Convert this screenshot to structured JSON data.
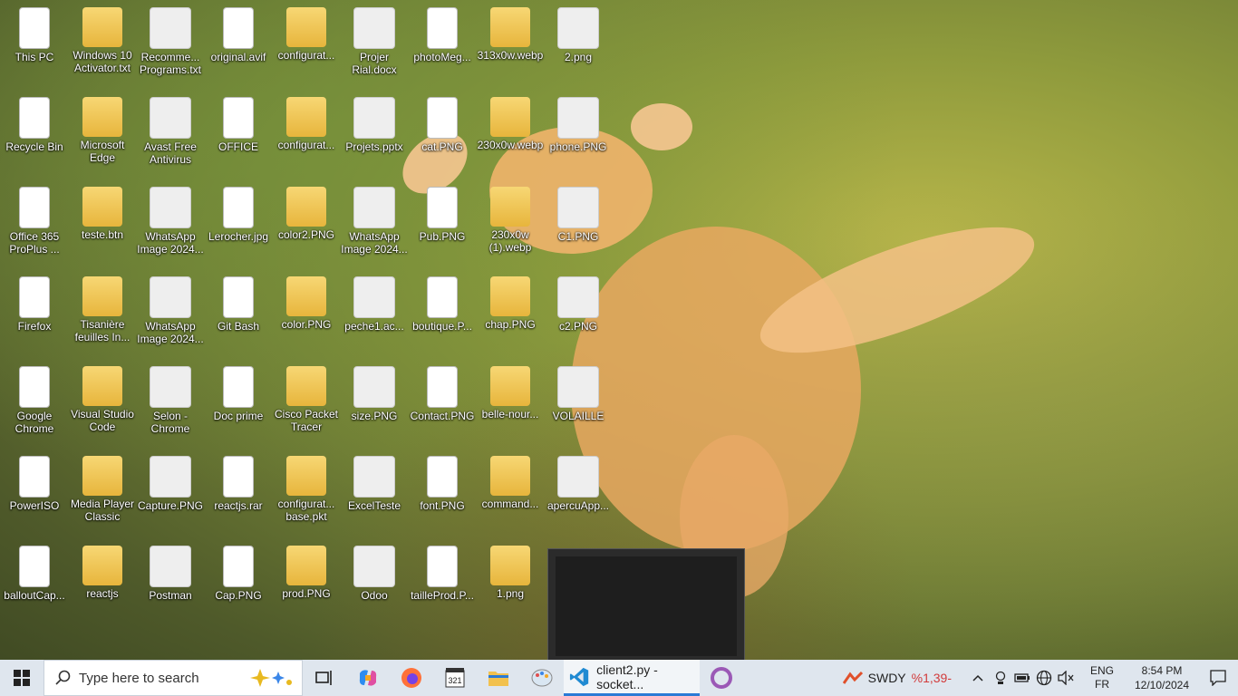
{
  "desktop": {
    "icons": [
      {
        "label": "This PC"
      },
      {
        "label": "Windows 10 Activator.txt"
      },
      {
        "label": "Recomme... Programs.txt"
      },
      {
        "label": "original.avif"
      },
      {
        "label": "configurat..."
      },
      {
        "label": "Projer Rial.docx"
      },
      {
        "label": "photoMeg..."
      },
      {
        "label": "313x0w.webp"
      },
      {
        "label": "2.png"
      },
      {
        "label": "Recycle Bin"
      },
      {
        "label": "Microsoft Edge"
      },
      {
        "label": "Avast Free Antivirus"
      },
      {
        "label": "OFFICE"
      },
      {
        "label": "configurat..."
      },
      {
        "label": "Projets.pptx"
      },
      {
        "label": "cat.PNG"
      },
      {
        "label": "230x0w.webp"
      },
      {
        "label": "phone.PNG"
      },
      {
        "label": "Office 365 ProPlus ..."
      },
      {
        "label": "teste.btn"
      },
      {
        "label": "WhatsApp Image 2024..."
      },
      {
        "label": "Lerocher.jpg"
      },
      {
        "label": "color2.PNG"
      },
      {
        "label": "WhatsApp Image 2024..."
      },
      {
        "label": "Pub.PNG"
      },
      {
        "label": "230x0w (1).webp"
      },
      {
        "label": "C1.PNG"
      },
      {
        "label": "Firefox"
      },
      {
        "label": "Tisanière feuilles In..."
      },
      {
        "label": "WhatsApp Image 2024..."
      },
      {
        "label": "Git Bash"
      },
      {
        "label": "color.PNG"
      },
      {
        "label": "peche1.ac..."
      },
      {
        "label": "boutique.P..."
      },
      {
        "label": "chap.PNG"
      },
      {
        "label": "c2.PNG"
      },
      {
        "label": "Google Chrome"
      },
      {
        "label": "Visual Studio Code"
      },
      {
        "label": "Selon - Chrome"
      },
      {
        "label": "Doc prime"
      },
      {
        "label": "Cisco Packet Tracer"
      },
      {
        "label": "size.PNG"
      },
      {
        "label": "Contact.PNG"
      },
      {
        "label": "belle-nour..."
      },
      {
        "label": "VOLAILLE"
      },
      {
        "label": "PowerISO"
      },
      {
        "label": "Media Player Classic"
      },
      {
        "label": "Capture.PNG"
      },
      {
        "label": "reactjs.rar"
      },
      {
        "label": "configurat... base.pkt"
      },
      {
        "label": "ExcelTeste"
      },
      {
        "label": "font.PNG"
      },
      {
        "label": "command..."
      },
      {
        "label": "apercuApp..."
      },
      {
        "label": "balloutCap..."
      },
      {
        "label": "reactjs"
      },
      {
        "label": "Postman"
      },
      {
        "label": "Cap.PNG"
      },
      {
        "label": "prod.PNG"
      },
      {
        "label": "Odoo"
      },
      {
        "label": "tailleProd.P..."
      },
      {
        "label": "1.png"
      }
    ]
  },
  "taskbar": {
    "search_placeholder": "Type here to search",
    "active_window": "client2.py - socket...",
    "stock_name": "SWDY",
    "stock_change": "%1,39-",
    "lang_top": "ENG",
    "lang_bottom": "FR",
    "time": "8:54 PM",
    "date": "12/10/2024"
  },
  "colors": {
    "accent": "#2b7bd6",
    "taskbar": "#dfe6ee",
    "stock_down": "#d23a3a"
  }
}
